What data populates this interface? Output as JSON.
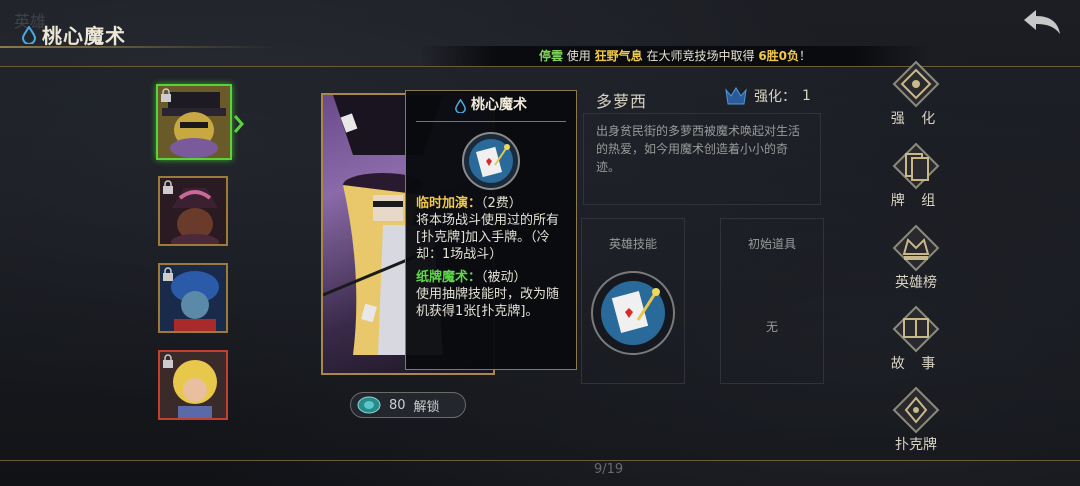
{
  "header": {
    "ghost_title": "英雄",
    "title": "桃心魔术"
  },
  "marquee": {
    "player": "停雲",
    "verb": "使用",
    "hero": "狂野气息",
    "middle": "在大师竞技场中取得",
    "record": "6胜0负",
    "end": "！"
  },
  "hero_list": [
    {
      "name": "hero-1",
      "selected": true,
      "locked": true
    },
    {
      "name": "hero-2",
      "selected": false,
      "locked": true
    },
    {
      "name": "hero-3",
      "selected": false,
      "locked": true
    },
    {
      "name": "hero-4",
      "selected": false,
      "locked": true
    }
  ],
  "unlock": {
    "cost": "80",
    "label": "解锁"
  },
  "tooltip": {
    "title": "桃心魔术",
    "skill1_name": "临时加演：",
    "skill1_cost": "（2费）",
    "skill1_desc": "将本场战斗使用过的所有[扑克牌]加入手牌。（冷却：1场战斗）",
    "skill2_name": "纸牌魔术：",
    "skill2_type": "（被动）",
    "skill2_desc": "使用抽牌技能时，改为随机获得1张[扑克牌]。"
  },
  "hero_info": {
    "name": "多萝西",
    "strength_label": "强化：",
    "strength_value": "1",
    "description": "出身贫民街的多萝西被魔术唤起对生活的热爱，如今用魔术创造着小小的奇迹。",
    "skill_label": "英雄技能",
    "item_label": "初始道具",
    "item_none": "无"
  },
  "side_menu": [
    {
      "key": "strengthen",
      "label": "强 化"
    },
    {
      "key": "deck",
      "label": "牌 组"
    },
    {
      "key": "leaderboard",
      "label": "英雄榜"
    },
    {
      "key": "story",
      "label": "故 事"
    },
    {
      "key": "poker",
      "label": "扑克牌"
    }
  ],
  "page": "9/19",
  "colors": {
    "accent_gold": "#a8894a",
    "highlight_green": "#5fd84a",
    "highlight_yellow": "#f0c84a",
    "selected_border": "#5bd23a",
    "danger_border": "#c2402e"
  },
  "icons": {
    "title": "water-drop-icon",
    "back": "back-arrow-icon",
    "strength": "crown-icon",
    "unlock": "coin-icon",
    "skill": "card-skill-icon"
  }
}
